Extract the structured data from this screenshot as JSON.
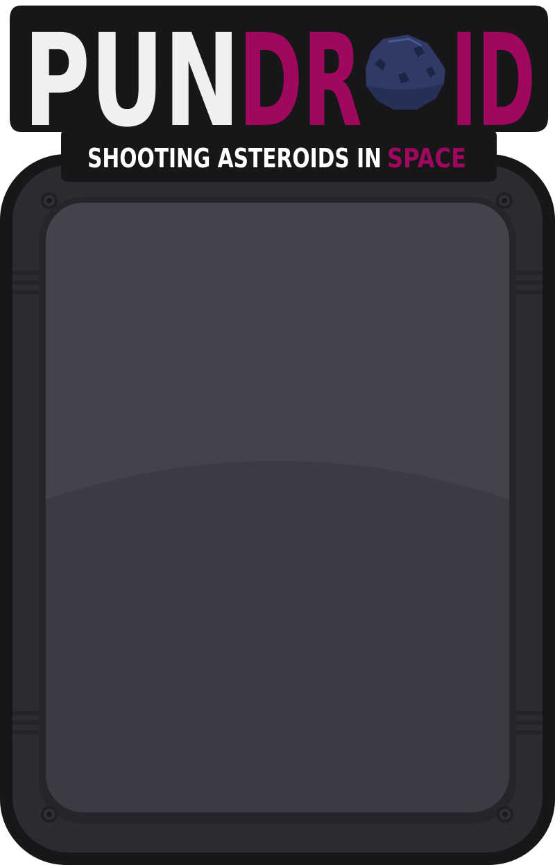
{
  "logo": {
    "title_part1": "PUN",
    "title_part2_a": "DR",
    "title_part2_b": "ID",
    "asteroid_icon": "asteroid-icon",
    "tagline_part1": "SHOOTING ASTEROIDS IN",
    "tagline_part2": "SPACE"
  },
  "colors": {
    "title_white": "#f0f0f0",
    "title_white_shadow": "#cfcfcf",
    "title_magenta": "#a0075e",
    "title_magenta_shadow": "#7d0a4f",
    "asteroid": "#2f3a66",
    "panel_frame": "#2b2b32",
    "panel_inner": "#43434d",
    "panel_inner_lower": "#3b3b44",
    "outline": "#17171a"
  }
}
